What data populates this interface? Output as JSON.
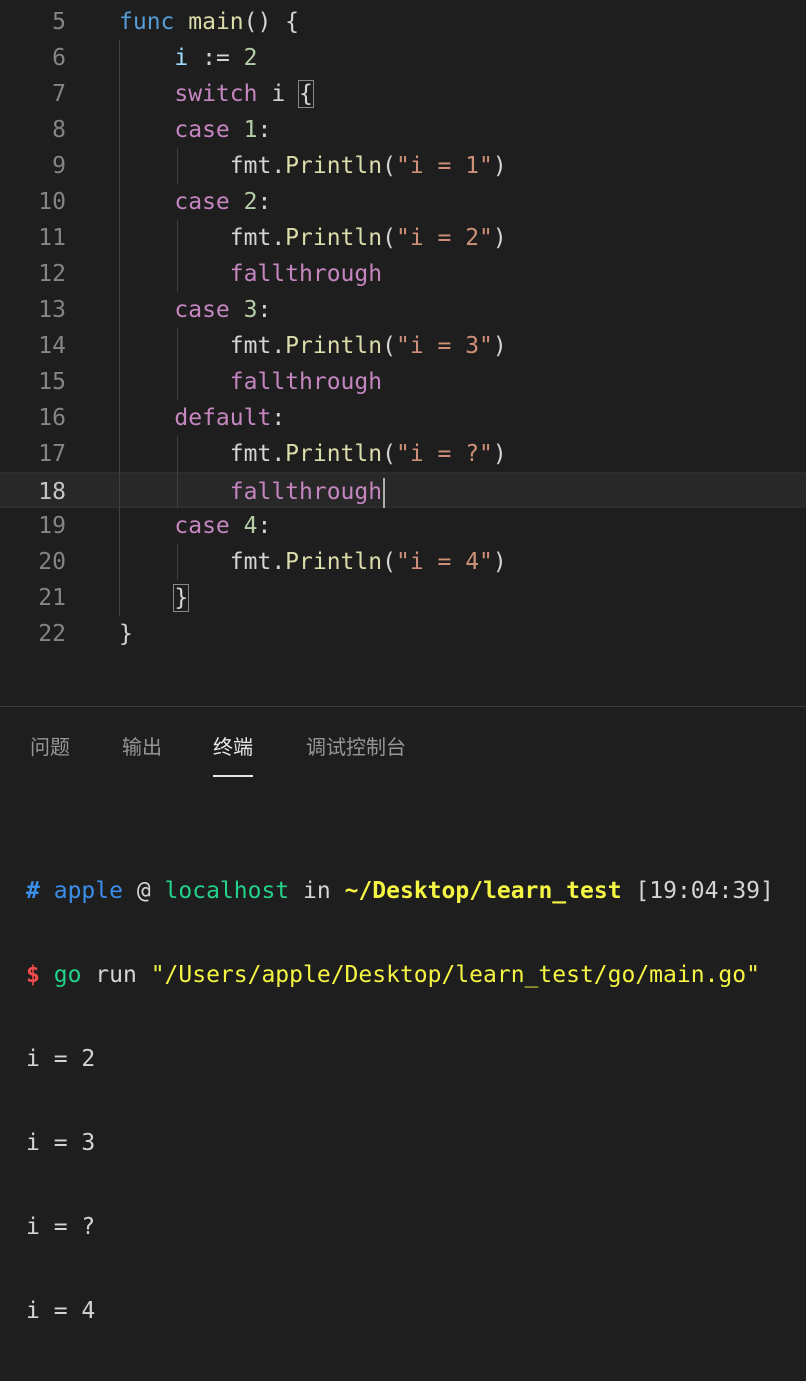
{
  "editor": {
    "lines": [
      {
        "n": "5",
        "parts": [
          [
            "kw",
            "func"
          ],
          [
            "pl",
            " "
          ],
          [
            "fn",
            "main"
          ],
          [
            "pl",
            "() {"
          ]
        ]
      },
      {
        "n": "6",
        "parts": [
          [
            "pl",
            "    "
          ],
          [
            "var",
            "i"
          ],
          [
            "pl",
            " := "
          ],
          [
            "num",
            "2"
          ]
        ]
      },
      {
        "n": "7",
        "parts": [
          [
            "pl",
            "    "
          ],
          [
            "ctl",
            "switch"
          ],
          [
            "pl",
            " i "
          ],
          [
            "bm",
            "{"
          ]
        ]
      },
      {
        "n": "8",
        "parts": [
          [
            "pl",
            "    "
          ],
          [
            "ctl",
            "case"
          ],
          [
            "pl",
            " "
          ],
          [
            "num",
            "1"
          ],
          [
            "pl",
            ":"
          ]
        ]
      },
      {
        "n": "9",
        "parts": [
          [
            "pl",
            "        fmt."
          ],
          [
            "fn",
            "Println"
          ],
          [
            "pl",
            "("
          ],
          [
            "str",
            "\"i = 1\""
          ],
          [
            "pl",
            ")"
          ]
        ]
      },
      {
        "n": "10",
        "parts": [
          [
            "pl",
            "    "
          ],
          [
            "ctl",
            "case"
          ],
          [
            "pl",
            " "
          ],
          [
            "num",
            "2"
          ],
          [
            "pl",
            ":"
          ]
        ]
      },
      {
        "n": "11",
        "parts": [
          [
            "pl",
            "        fmt."
          ],
          [
            "fn",
            "Println"
          ],
          [
            "pl",
            "("
          ],
          [
            "str",
            "\"i = 2\""
          ],
          [
            "pl",
            ")"
          ]
        ]
      },
      {
        "n": "12",
        "parts": [
          [
            "pl",
            "        "
          ],
          [
            "ctl",
            "fallthrough"
          ]
        ]
      },
      {
        "n": "13",
        "parts": [
          [
            "pl",
            "    "
          ],
          [
            "ctl",
            "case"
          ],
          [
            "pl",
            " "
          ],
          [
            "num",
            "3"
          ],
          [
            "pl",
            ":"
          ]
        ]
      },
      {
        "n": "14",
        "parts": [
          [
            "pl",
            "        fmt."
          ],
          [
            "fn",
            "Println"
          ],
          [
            "pl",
            "("
          ],
          [
            "str",
            "\"i = 3\""
          ],
          [
            "pl",
            ")"
          ]
        ]
      },
      {
        "n": "15",
        "parts": [
          [
            "pl",
            "        "
          ],
          [
            "ctl",
            "fallthrough"
          ]
        ]
      },
      {
        "n": "16",
        "parts": [
          [
            "pl",
            "    "
          ],
          [
            "ctl",
            "default"
          ],
          [
            "pl",
            ":"
          ]
        ]
      },
      {
        "n": "17",
        "parts": [
          [
            "pl",
            "        fmt."
          ],
          [
            "fn",
            "Println"
          ],
          [
            "pl",
            "("
          ],
          [
            "str",
            "\"i = ?\""
          ],
          [
            "pl",
            ")"
          ]
        ]
      },
      {
        "n": "18",
        "parts": [
          [
            "pl",
            "        "
          ],
          [
            "ctl",
            "fallthrough"
          ]
        ],
        "current": true
      },
      {
        "n": "19",
        "parts": [
          [
            "pl",
            "    "
          ],
          [
            "ctl",
            "case"
          ],
          [
            "pl",
            " "
          ],
          [
            "num",
            "4"
          ],
          [
            "pl",
            ":"
          ]
        ]
      },
      {
        "n": "20",
        "parts": [
          [
            "pl",
            "        fmt."
          ],
          [
            "fn",
            "Println"
          ],
          [
            "pl",
            "("
          ],
          [
            "str",
            "\"i = 4\""
          ],
          [
            "pl",
            ")"
          ]
        ]
      },
      {
        "n": "21",
        "parts": [
          [
            "pl",
            "    "
          ],
          [
            "bm",
            "}"
          ]
        ]
      },
      {
        "n": "22",
        "parts": [
          [
            "pl",
            "}"
          ]
        ]
      }
    ]
  },
  "panel": {
    "tabs": {
      "problems": "问题",
      "output": "输出",
      "terminal": "终端",
      "debug_console": "调试控制台"
    },
    "active_tab": "终端"
  },
  "terminal": {
    "prompt_hash": "#",
    "user": "apple",
    "at": "@",
    "host": "localhost",
    "in": "in",
    "cwd": "~/Desktop/learn_test",
    "time": "[19:04:39]",
    "dollar": "$",
    "cmd": "go",
    "cmd_rest": "run",
    "cmd_arg": "\"/Users/apple/Desktop/learn_test/go/main.go\"",
    "output": [
      "i = 2",
      "i = 3",
      "i = ?",
      "i = 4"
    ]
  }
}
